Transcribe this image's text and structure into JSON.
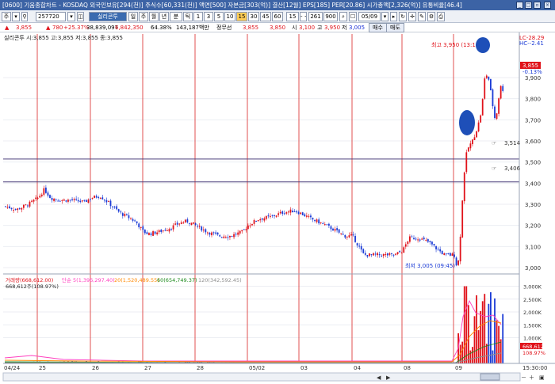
{
  "window": {
    "title": "[0600] 기움종합차트 - KOSDAQ 외국인보유[294(천)] 주식수[60,331(천)] 액면[500] 자본금[303(억)] 결산[12월] EPS[185] PER[20.86] 시가총액[2,326(억)] 유통비율[46.4]"
  },
  "toolbar": {
    "mode": "주",
    "stock_code": "257720",
    "stock_name": "실리콘투",
    "periods": [
      "틱",
      "1",
      "3",
      "5",
      "10",
      "15",
      "30",
      "45",
      "60"
    ],
    "selected_period": "15",
    "count": "15",
    "unit": "- ~",
    "bars": "261",
    "total": "900",
    "date": "05/09"
  },
  "pricebar": {
    "price": "3,855",
    "change": "780",
    "change_pct": "+25.37%",
    "volume": "38,839,097",
    "volume_change": "6,842,350",
    "vol_pct": "64.38%",
    "amount": "143,187백만",
    "broker": "정무선",
    "bid": "3,855",
    "ask": "3,850",
    "open_label": "시",
    "open": "3,100",
    "high_label": "고",
    "high": "3,950",
    "low_label": "저",
    "low": "3,005",
    "buy": "매수",
    "sell": "매도"
  },
  "price_panel": {
    "legend": "실리콘투 시:3,855 고:3,855 저:3,855 종:3,855",
    "high_annotation": "최고 3,950 (13:15)",
    "low_annotation": "최저 3,005 (09:45)",
    "lc": "LC-28.29",
    "hc": "HC--2.41",
    "current_price": "3,855",
    "current_pct": "-0.13%",
    "level_1": "3,514",
    "level_2": "3,406",
    "y_labels": [
      "3,900",
      "3,800",
      "3,700",
      "3,600",
      "3,500",
      "3,400",
      "3,300",
      "3,200",
      "3,100",
      "3,000"
    ]
  },
  "volume_panel": {
    "legend_1": "거래량(668,612.00)",
    "legend_2": "단순 5(1,396,297.40)",
    "legend_3": "20(1,520,489.55)",
    "legend_4": "60(654,749.37)",
    "legend_5": "120(342,592.45)",
    "current": "668,612주(108.97%)",
    "box_value": "668,612",
    "box_pct": "108.97%",
    "y_labels": [
      "3,000K",
      "2,500K",
      "2,000K",
      "1,500K",
      "1,000K"
    ]
  },
  "x_axis": {
    "labels": [
      "04/24",
      "25",
      "26",
      "27",
      "28",
      "05/02",
      "03",
      "04",
      "08",
      "09"
    ],
    "time": "15:30:00"
  },
  "colors": {
    "up": "#e0121a",
    "down": "#1b3bd6",
    "ma_pink": "#ff3fbf",
    "ma_orange": "#ff8800",
    "ma_green": "#1b8a1b",
    "ma_gray": "#8e8e8e",
    "level_line": "#4a3d7a",
    "session_line": "#d92626",
    "highlight": "#1e4fb8"
  }
}
